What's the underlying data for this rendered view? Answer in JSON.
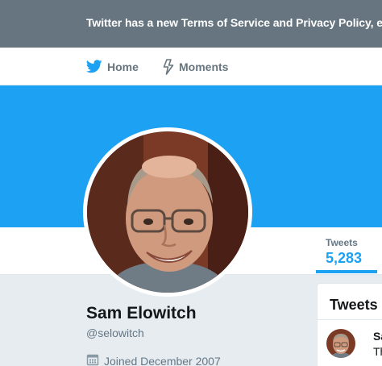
{
  "banner": {
    "text": "Twitter has a new Terms of Service and Privacy Policy, effe"
  },
  "nav": {
    "home_label": "Home",
    "moments_label": "Moments"
  },
  "profile_nav": {
    "tweets_label": "Tweets",
    "tweets_count": "5,283"
  },
  "profile": {
    "name": "Sam Elowitch",
    "handle": "@selowitch",
    "joined": "Joined December 2007"
  },
  "tweets_card": {
    "title": "Tweets",
    "first_tweet_name": "Sa",
    "first_tweet_text": "Th"
  },
  "colors": {
    "brand_blue": "#1da1f2",
    "banner_gray": "#66757f",
    "text_dark": "#14171a",
    "text_muted": "#657786"
  },
  "icons": {
    "home": "twitter-bird-icon",
    "moments": "lightning-icon",
    "joined": "calendar-icon"
  }
}
